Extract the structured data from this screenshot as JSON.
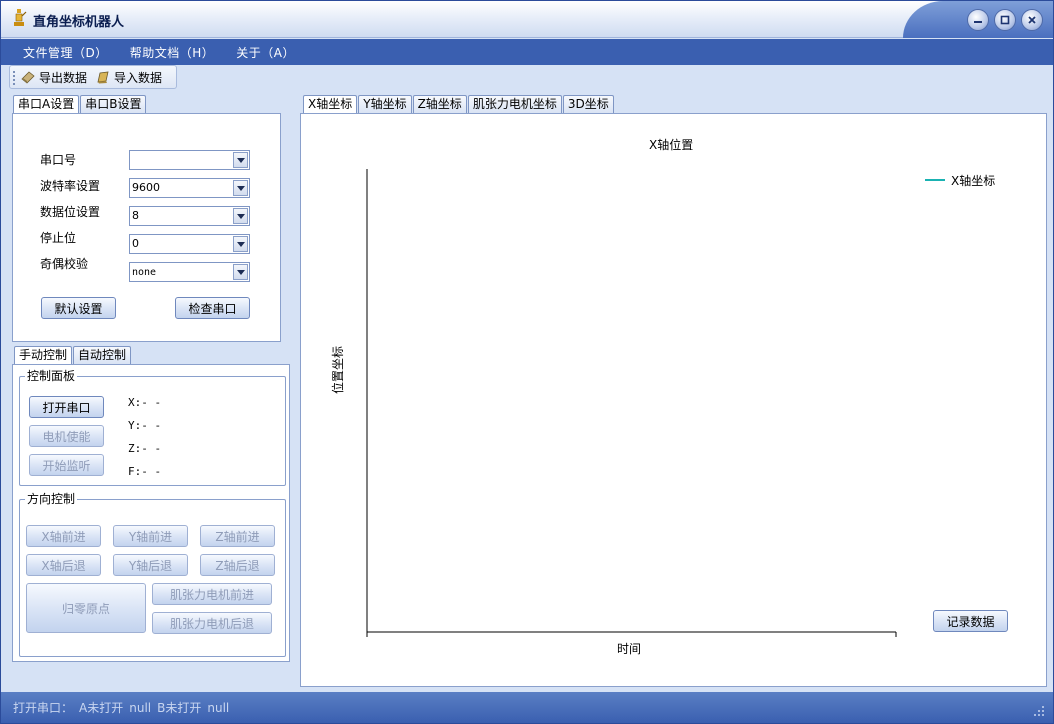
{
  "window": {
    "title": "直角坐标机器人"
  },
  "menu": [
    "文件管理（D）",
    "帮助文档（H）",
    "关于（A）"
  ],
  "toolbar": {
    "export_label": "导出数据",
    "import_label": "导入数据"
  },
  "serial_tabs": [
    "串口A设置",
    "串口B设置"
  ],
  "serial": {
    "port_label": "串口号",
    "port_value": "",
    "baud_label": "波特率设置",
    "baud_value": "9600",
    "databits_label": "数据位设置",
    "databits_value": "8",
    "stopbits_label": "停止位",
    "stopbits_value": "0",
    "parity_label": "奇偶校验",
    "parity_value": "none",
    "default_button": "默认设置",
    "check_button": "检查串口"
  },
  "control_tabs": [
    "手动控制",
    "自动控制"
  ],
  "control_panel": {
    "title": "控制面板",
    "open_port": "打开串口",
    "motor_enable": "电机使能",
    "start_listen": "开始监听",
    "readouts": [
      "X:- -",
      "Y:- -",
      "Z:- -",
      "F:- -"
    ]
  },
  "direction": {
    "title": "方向控制",
    "x_forward": "X轴前进",
    "y_forward": "Y轴前进",
    "z_forward": "Z轴前进",
    "x_back": "X轴后退",
    "y_back": "Y轴后退",
    "z_back": "Z轴后退",
    "home": "归零原点",
    "muscle_forward": "肌张力电机前进",
    "muscle_back": "肌张力电机后退"
  },
  "chart_tabs": [
    "X轴坐标",
    "Y轴坐标",
    "Z轴坐标",
    "肌张力电机坐标",
    "3D坐标"
  ],
  "chart_data": {
    "type": "line",
    "title": "X轴位置",
    "xlabel": "时间",
    "ylabel": "位置坐标",
    "series": [
      {
        "name": "X轴坐标",
        "values": []
      }
    ],
    "legend": "top-right",
    "line_color": "#1ab2b2"
  },
  "record_button": "记录数据",
  "status": {
    "label": "打开串口：",
    "a_state": "A未打开",
    "a_value": "null",
    "b_state": "B未打开",
    "b_value": "null"
  }
}
